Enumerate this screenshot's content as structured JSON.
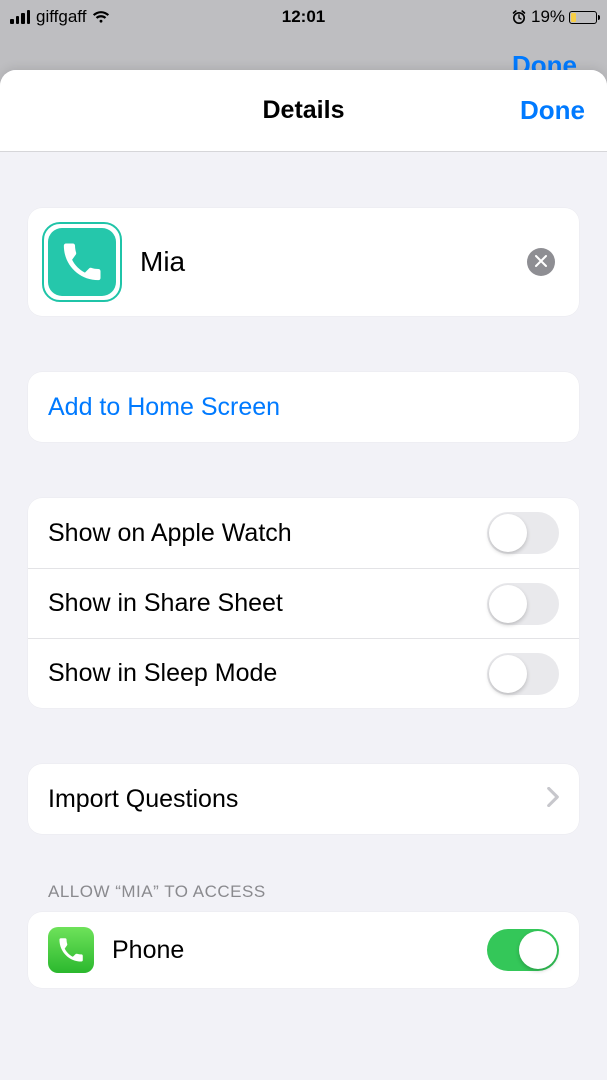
{
  "status_bar": {
    "carrier": "giffgaff",
    "time": "12:01",
    "battery_percent": "19%"
  },
  "background_done": "Done",
  "nav": {
    "title": "Details",
    "done": "Done"
  },
  "shortcut": {
    "name": "Mia",
    "icon_color": "#25c7ab"
  },
  "actions": {
    "add_to_home": "Add to Home Screen"
  },
  "toggles": {
    "apple_watch": {
      "label": "Show on Apple Watch",
      "on": false
    },
    "share_sheet": {
      "label": "Show in Share Sheet",
      "on": false
    },
    "sleep_mode": {
      "label": "Show in Sleep Mode",
      "on": false
    }
  },
  "import_questions": "Import Questions",
  "access": {
    "header": "ALLOW “MIA” TO ACCESS",
    "items": {
      "phone": {
        "label": "Phone",
        "on": true
      }
    }
  }
}
